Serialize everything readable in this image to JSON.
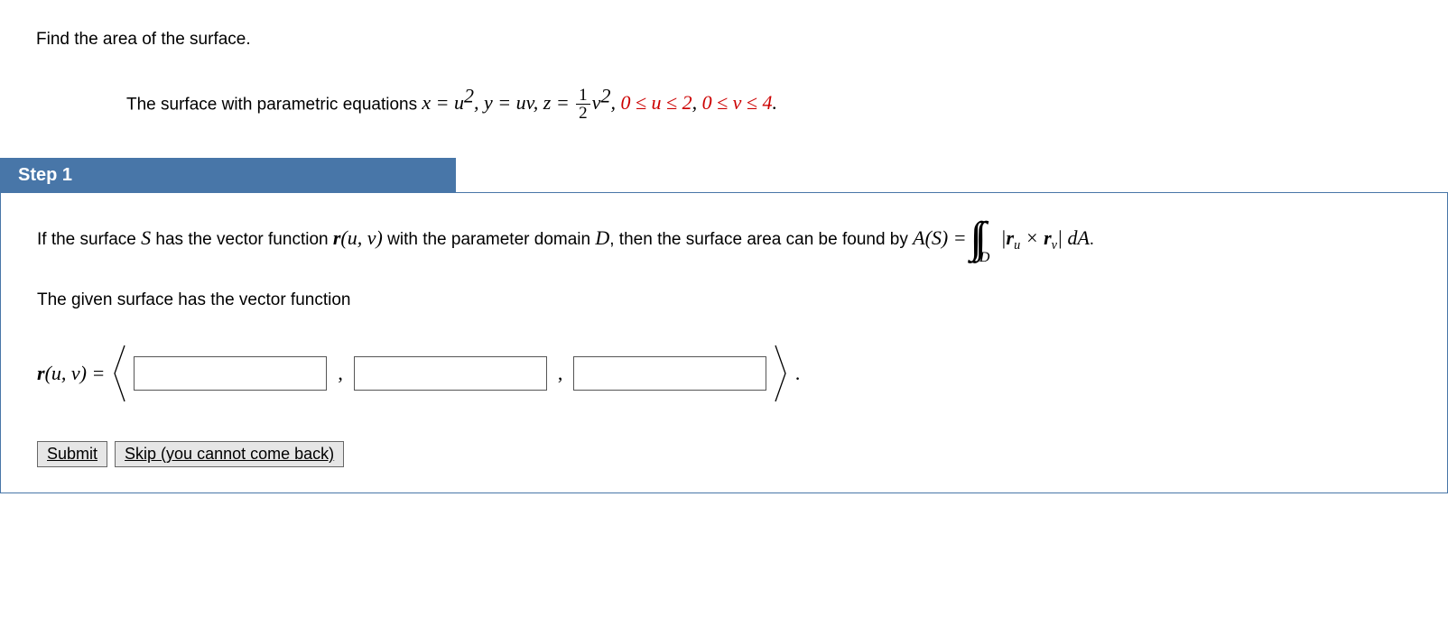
{
  "problem": {
    "prompt": "Find the area of the surface.",
    "equations_prefix": "The surface with parametric equations ",
    "eq_x_lhs": "x = u",
    "eq_x_sup": "2",
    "eq_y": ", y = uv, z = ",
    "frac_top": "1",
    "frac_bot": "2",
    "eq_z_rhs": "v",
    "eq_z_sup": "2",
    "domain_sep": ", ",
    "domain_u": "0 ≤ u ≤ 2",
    "domain_mid": ", ",
    "domain_v": "0 ≤ v ≤ 4",
    "domain_end": "."
  },
  "step": {
    "label": "Step 1",
    "explain_pre": "If the surface ",
    "S": "S",
    "explain_mid1": " has the vector function  ",
    "r": "r",
    "uv_args": "(u, v)",
    "explain_mid2": "  with the parameter domain ",
    "D": "D",
    "explain_mid3": ", then the surface area can be found by  ",
    "AS": "A(S) = ",
    "integrand_open": "|",
    "ru_r": "r",
    "ru_sub": "u",
    "cross": " × ",
    "rv_r": "r",
    "rv_sub": "v",
    "integrand_close": "| ",
    "dA": "dA",
    "period": ".",
    "given_line": "The given surface has the vector function",
    "r_label": "r",
    "r_args": "(u, v) = ",
    "final_period": "."
  },
  "buttons": {
    "submit": "Submit",
    "skip": "Skip (you cannot come back)"
  }
}
